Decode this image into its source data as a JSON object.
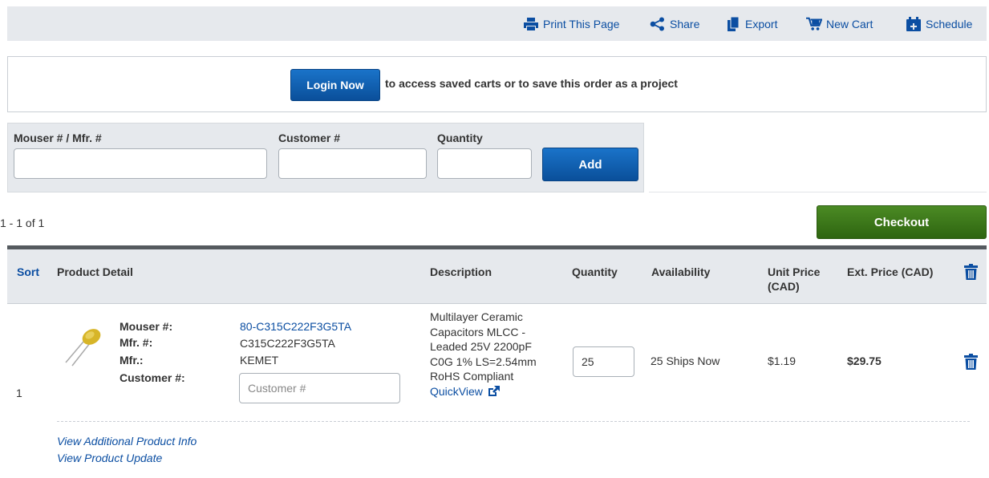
{
  "toolbar": {
    "print": "Print This Page",
    "share": "Share",
    "export": "Export",
    "new_cart": "New Cart",
    "schedule": "Schedule"
  },
  "login": {
    "button": "Login Now",
    "message": "to access saved carts or to save this order as a project"
  },
  "add_part": {
    "mouser_label": "Mouser # / Mfr. #",
    "mouser_value": "",
    "customer_label": "Customer #",
    "customer_value": "",
    "quantity_label": "Quantity",
    "quantity_value": "",
    "add_button": "Add"
  },
  "results": {
    "count": "1 - 1 of 1",
    "checkout_button": "Checkout"
  },
  "table": {
    "headers": {
      "sort": "Sort",
      "product_detail": "Product Detail",
      "description": "Description",
      "quantity": "Quantity",
      "availability": "Availability",
      "unit_price_1": "Unit Price",
      "unit_price_2": "(CAD)",
      "ext_price": "Ext. Price (CAD)"
    },
    "rows": [
      {
        "index": "1",
        "labels": {
          "mouser": "Mouser #:",
          "mfr_num": "Mfr. #:",
          "mfr": "Mfr.:",
          "customer": "Customer #:"
        },
        "mouser_num": "80-C315C222F3G5TA",
        "mfr_num": "C315C222F3G5TA",
        "mfr": "KEMET",
        "customer_placeholder": "Customer #",
        "description_lines": [
          "Multilayer Ceramic",
          "Capacitors MLCC -",
          "Leaded 25V 2200pF",
          "C0G 1% LS=2.54mm",
          "RoHS Compliant"
        ],
        "quickview": "QuickView",
        "quantity": "25",
        "availability": "25  Ships Now",
        "unit_price": "$1.19",
        "ext_price": "$29.75"
      }
    ],
    "extra_links": {
      "additional_info": "View Additional Product Info",
      "product_update": "View Product Update"
    }
  },
  "colors": {
    "link_blue": "#0b4ea2",
    "checkout_green": "#3c7a1a",
    "panel_gray": "#e6e9ed"
  }
}
